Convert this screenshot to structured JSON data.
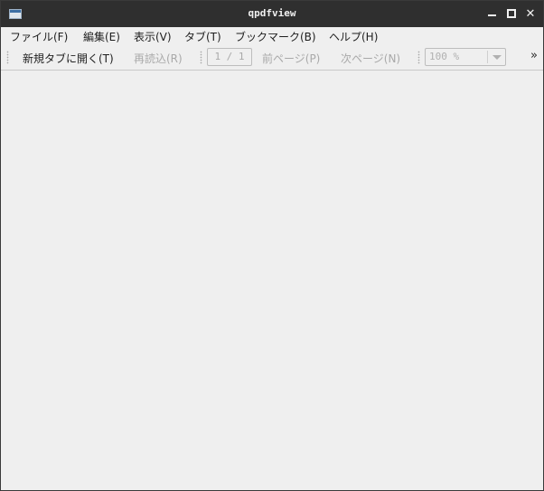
{
  "window": {
    "title": "qpdfview",
    "app_icon": "window-icon",
    "controls": {
      "minimize": "minimize-icon",
      "maximize": "maximize-icon",
      "close": "close-icon",
      "close_glyph": "✕"
    }
  },
  "menubar": {
    "items": [
      {
        "label": "ファイル(F)"
      },
      {
        "label": "編集(E)"
      },
      {
        "label": "表示(V)"
      },
      {
        "label": "タブ(T)"
      },
      {
        "label": "ブックマーク(B)"
      },
      {
        "label": "ヘルプ(H)"
      }
    ]
  },
  "toolbar": {
    "open_in_new_tab": "新規タブに開く(T)",
    "reload": "再読込(R)",
    "page_indicator": "1 / 1",
    "previous_page": "前ページ(P)",
    "next_page": "次ページ(N)",
    "zoom_value": "100 %",
    "overflow_glyph": "»"
  }
}
